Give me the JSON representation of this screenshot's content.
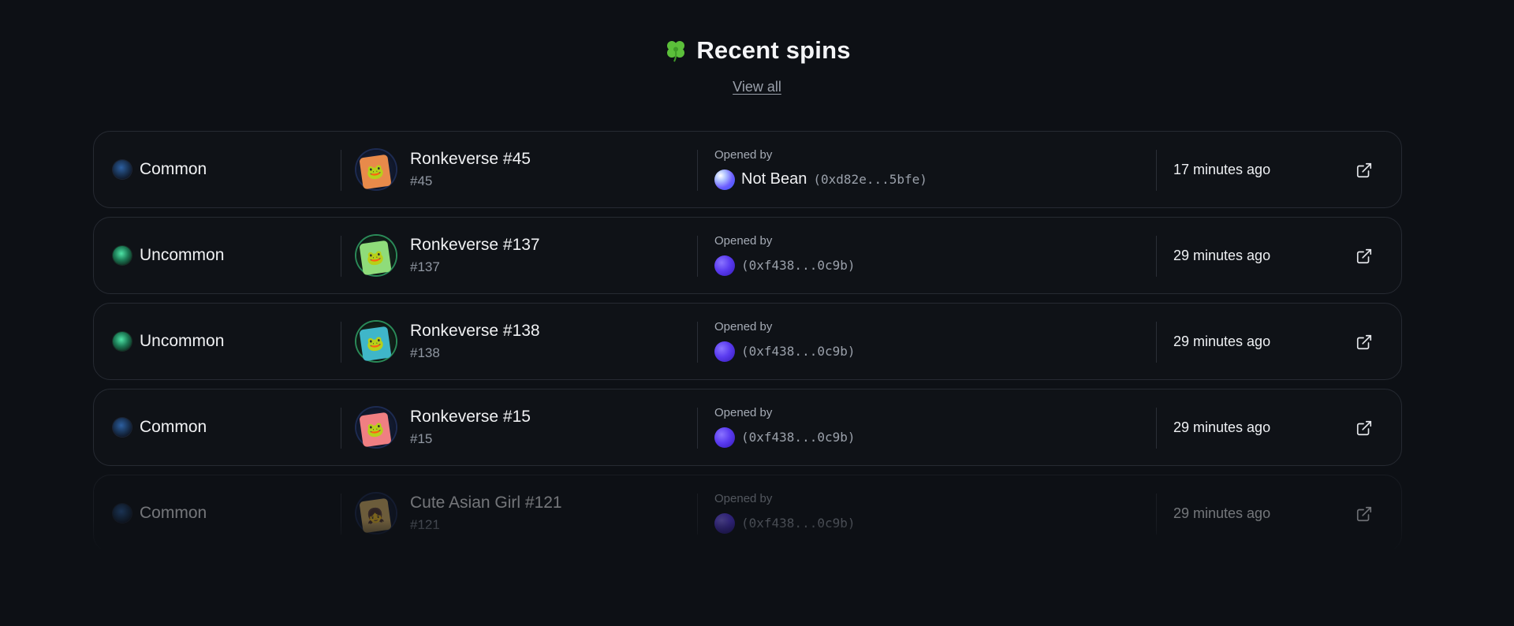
{
  "header": {
    "title": "Recent spins",
    "title_icon": "four-leaf-clover-icon",
    "view_all_label": "View all"
  },
  "colors": {
    "background": "#0d1015",
    "row_border": "#262a32",
    "common_orb": "#2d5fa0",
    "uncommon_orb": "#4fe3a6",
    "user_orb": "#5b3cf0"
  },
  "spins": [
    {
      "rarity": "Common",
      "rarity_orb": "common",
      "item_name": "Ronkeverse #45",
      "item_number": "#45",
      "opened_by_label": "Opened by",
      "user_name": "Not Bean",
      "user_address": "(0xd82e...5bfe)",
      "time_ago": "17 minutes ago"
    },
    {
      "rarity": "Uncommon",
      "rarity_orb": "uncommon",
      "item_name": "Ronkeverse #137",
      "item_number": "#137",
      "opened_by_label": "Opened by",
      "user_name": "",
      "user_address": "(0xf438...0c9b)",
      "time_ago": "29 minutes ago"
    },
    {
      "rarity": "Uncommon",
      "rarity_orb": "uncommon",
      "item_name": "Ronkeverse #138",
      "item_number": "#138",
      "opened_by_label": "Opened by",
      "user_name": "",
      "user_address": "(0xf438...0c9b)",
      "time_ago": "29 minutes ago"
    },
    {
      "rarity": "Common",
      "rarity_orb": "common",
      "item_name": "Ronkeverse #15",
      "item_number": "#15",
      "opened_by_label": "Opened by",
      "user_name": "",
      "user_address": "(0xf438...0c9b)",
      "time_ago": "29 minutes ago"
    },
    {
      "rarity": "Common",
      "rarity_orb": "common",
      "item_name": "Cute Asian Girl #121",
      "item_number": "#121",
      "opened_by_label": "Opened by",
      "user_name": "",
      "user_address": "(0xf438...0c9b)",
      "time_ago": "29 minutes ago"
    }
  ]
}
